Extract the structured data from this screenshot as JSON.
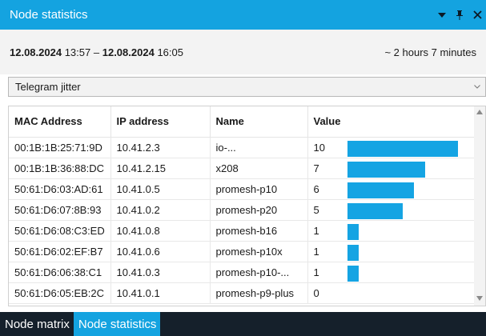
{
  "window": {
    "title": "Node statistics",
    "icons": [
      "dropdown-arrow-icon",
      "pin-icon",
      "close-icon"
    ]
  },
  "date_range": {
    "start_date": "12.08.2024",
    "start_time": "13:57",
    "separator": "–",
    "end_date": "12.08.2024",
    "end_time": "16:05",
    "duration": "~ 2 hours 7 minutes"
  },
  "metric_select": {
    "value": "Telegram jitter"
  },
  "table": {
    "headers": [
      "MAC Address",
      "IP address",
      "Name",
      "Value"
    ],
    "max_value": 10,
    "bar_color": "#15a4e3",
    "rows": [
      {
        "mac": "00:1B:1B:25:71:9D",
        "ip": "10.41.2.3",
        "name": "io-...",
        "value": "10",
        "level": 1.0
      },
      {
        "mac": "00:1B:1B:36:88:DC",
        "ip": "10.41.2.15",
        "name": "x208",
        "value": "7",
        "level": 0.7
      },
      {
        "mac": "50:61:D6:03:AD:61",
        "ip": "10.41.0.5",
        "name": "promesh-p10",
        "value": "6",
        "level": 0.6
      },
      {
        "mac": "50:61:D6:07:8B:93",
        "ip": "10.41.0.2",
        "name": "promesh-p20",
        "value": "5",
        "level": 0.5
      },
      {
        "mac": "50:61:D6:08:C3:ED",
        "ip": "10.41.0.8",
        "name": "promesh-b16",
        "value": "1",
        "level": 0.1
      },
      {
        "mac": "50:61:D6:02:EF:B7",
        "ip": "10.41.0.6",
        "name": "promesh-p10x",
        "value": "1",
        "level": 0.1
      },
      {
        "mac": "50:61:D6:06:38:C1",
        "ip": "10.41.0.3",
        "name": "promesh-p10-...",
        "value": "1",
        "level": 0.1
      },
      {
        "mac": "50:61:D6:05:EB:2C",
        "ip": "10.41.0.1",
        "name": "promesh-p9-plus",
        "value": "0",
        "level": 0.0
      }
    ]
  },
  "tabs": [
    {
      "label": "Node matrix",
      "active": false
    },
    {
      "label": "Node statistics",
      "active": true
    }
  ],
  "colors": {
    "accent": "#14a3e0",
    "tabbar_background": "#15202b"
  }
}
